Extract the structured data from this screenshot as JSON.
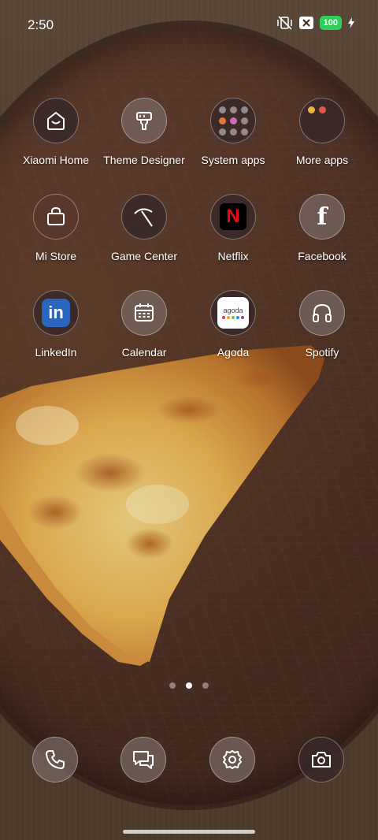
{
  "status_bar": {
    "time": "2:50",
    "battery": "100",
    "icons": [
      "vibrate-off-icon",
      "close-box-icon",
      "battery-icon",
      "charging-bolt-icon"
    ]
  },
  "apps": [
    {
      "label": "Xiaomi Home",
      "icon": "xiaomi-home-icon"
    },
    {
      "label": "Theme Designer",
      "icon": "theme-designer-icon"
    },
    {
      "label": "System apps",
      "icon": "folder-icon"
    },
    {
      "label": "More apps",
      "icon": "folder-icon"
    },
    {
      "label": "Mi Store",
      "icon": "shopping-bag-icon"
    },
    {
      "label": "Game Center",
      "icon": "game-center-icon"
    },
    {
      "label": "Netflix",
      "icon": "netflix-icon"
    },
    {
      "label": "Facebook",
      "icon": "facebook-icon"
    },
    {
      "label": "LinkedIn",
      "icon": "linkedin-icon"
    },
    {
      "label": "Calendar",
      "icon": "calendar-icon"
    },
    {
      "label": "Agoda",
      "icon": "agoda-icon"
    },
    {
      "label": "Spotify",
      "icon": "headphones-icon"
    }
  ],
  "icon_text": {
    "netflix": "N",
    "linkedin": "in",
    "agoda": "agoda",
    "facebook": "f"
  },
  "pager": {
    "count": 3,
    "active": 1
  },
  "dock": [
    "phone-icon",
    "messages-icon",
    "settings-icon",
    "camera-icon"
  ],
  "colors": {
    "battery": "#2fd05a",
    "netflix": "#e50914",
    "linkedin": "#2a66bd",
    "agoda_dots": [
      "#e5363d",
      "#f5a623",
      "#7ac142",
      "#3b8fd9",
      "#8e44ad"
    ]
  }
}
